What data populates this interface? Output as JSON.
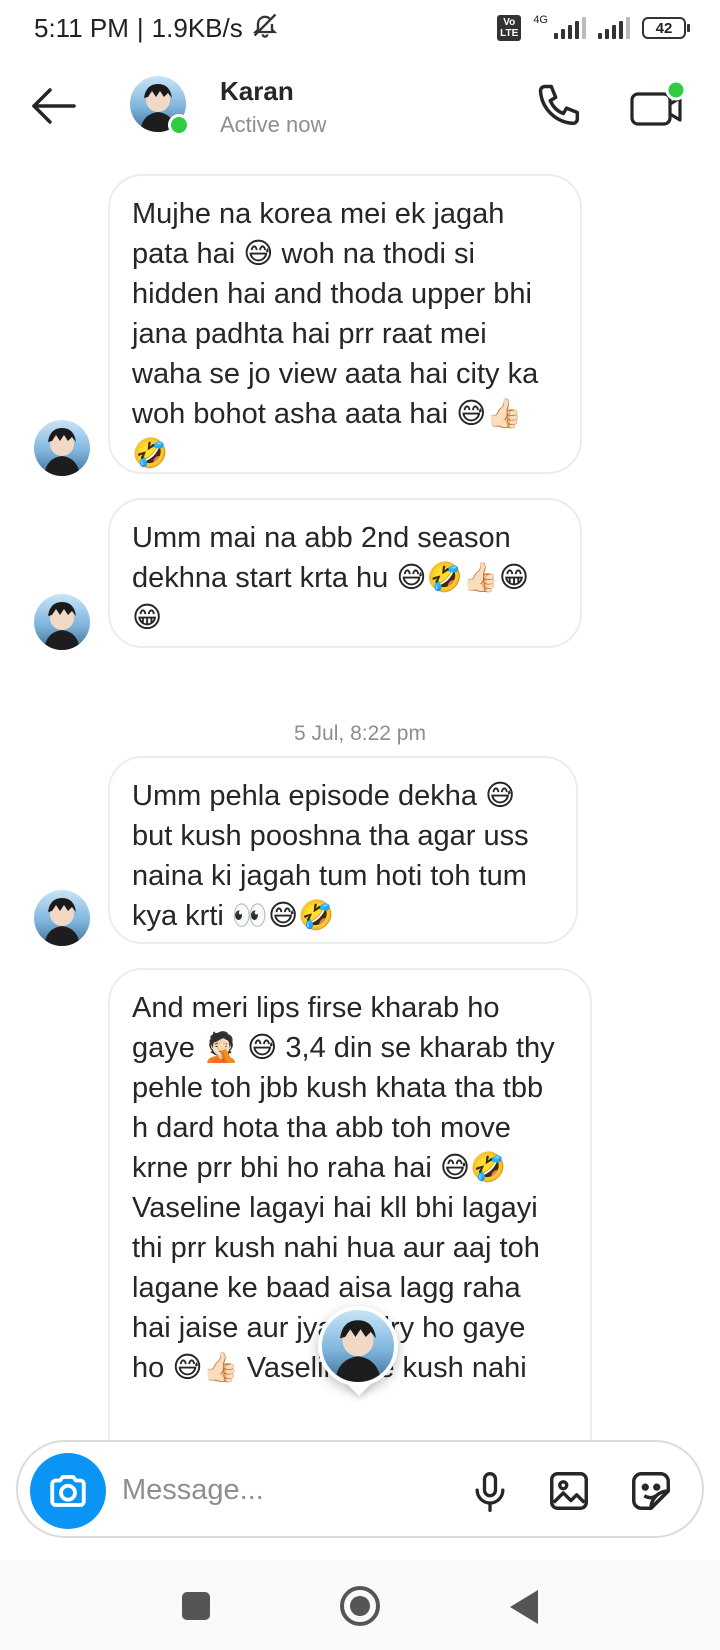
{
  "status_bar": {
    "time": "5:11 PM",
    "separator": "|",
    "speed": "1.9KB/s",
    "network_type": "4G",
    "volte_label": "Vo\nLTE",
    "battery": "42"
  },
  "header": {
    "contact_name": "Karan",
    "contact_status": "Active now"
  },
  "messages": [
    {
      "text": "Mujhe na korea mei ek jagah\npata hai 😅 woh na thodi si\nhidden hai and thoda upper bhi\njana padhta hai prr raat mei\nwaha se jo view aata hai city ka\nwoh bohot asha aata hai 😅👍🏻\n🤣"
    },
    {
      "text": "Umm mai na abb 2nd season\ndekhna start krta hu 😅🤣👍🏻😁\n😁"
    },
    {
      "text": "Umm pehla episode dekha 😅\nbut kush pooshna tha agar uss\nnaina ki jagah tum hoti toh tum\nkya krti 👀😅🤣"
    },
    {
      "text": "And meri lips firse kharab ho\ngaye 🤦🏻 😅 3,4 din se kharab thy\npehle toh jbb kush khata tha tbb\nh dard hota tha abb toh move\nkrne prr bhi ho raha hai 😅🤣\nVaseline lagayi hai kll bhi lagayi\nthi prr kush nahi hua aur aaj toh\nlagane ke baad aisa lagg raha\nhai jaise aur jyada dry ho gaye\nho 😅👍🏻 Vaseline se kush nahi"
    }
  ],
  "timestamp": "5 Jul, 8:22 pm",
  "composer": {
    "placeholder": "Message..."
  },
  "icons": {
    "back": "arrow-left-icon",
    "call": "phone-icon",
    "video": "video-camera-icon",
    "camera": "camera-icon",
    "mic": "microphone-icon",
    "gallery": "image-icon",
    "sticker": "sticker-icon"
  },
  "colors": {
    "accent_blue": "#0a95f6",
    "online_green": "#2ecc40",
    "bubble_border": "#ececec",
    "secondary_text": "#8e8e8e"
  }
}
